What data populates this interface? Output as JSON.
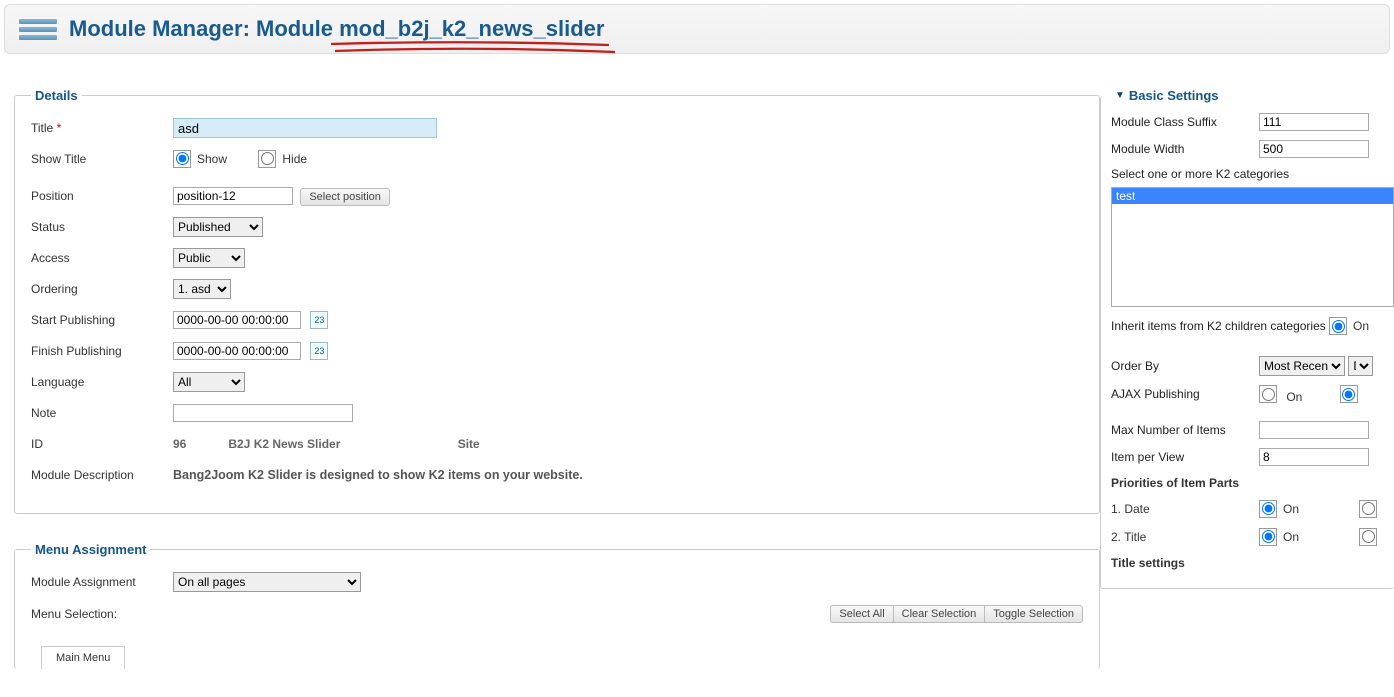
{
  "header": {
    "title": "Module Manager: Module mod_b2j_k2_news_slider"
  },
  "details": {
    "legend": "Details",
    "title_label": "Title",
    "title_value": "asd",
    "showtitle_label": "Show Title",
    "show_opt": "Show",
    "hide_opt": "Hide",
    "position_label": "Position",
    "position_value": "position-12",
    "select_position_btn": "Select position",
    "status_label": "Status",
    "status_value": "Published",
    "access_label": "Access",
    "access_value": "Public",
    "ordering_label": "Ordering",
    "ordering_value": "1. asd",
    "start_label": "Start Publishing",
    "start_value": "0000-00-00 00:00:00",
    "finish_label": "Finish Publishing",
    "finish_value": "0000-00-00 00:00:00",
    "language_label": "Language",
    "language_value": "All",
    "note_label": "Note",
    "note_value": "",
    "id_label": "ID",
    "id_value": "96",
    "module_name": "B2J K2 News Slider",
    "client": "Site",
    "desc_label": "Module Description",
    "desc_value": "Bang2Joom K2 Slider is designed to show K2 items on your website."
  },
  "menu": {
    "legend": "Menu Assignment",
    "assignment_label": "Module Assignment",
    "assignment_value": "On all pages",
    "selection_label": "Menu Selection:",
    "select_all": "Select All",
    "clear_selection": "Clear Selection",
    "toggle_selection": "Toggle Selection",
    "tab_main": "Main Menu"
  },
  "basic": {
    "legend": "Basic Settings",
    "suffix_label": "Module Class Suffix",
    "suffix_value": "111",
    "width_label": "Module Width",
    "width_value": "500",
    "k2cat_label": "Select one or more K2 categories",
    "k2cat_options": [
      "test"
    ],
    "inherit_label": "Inherit items from K2 children categories",
    "on": "On",
    "orderby_label": "Order By",
    "orderby_value": "Most Recent",
    "orderby_dir": "De",
    "ajax_label": "AJAX Publishing",
    "maxitems_label": "Max Number of Items",
    "maxitems_value": "",
    "perview_label": "Item per View",
    "perview_value": "8",
    "priorities_label": "Priorities of Item Parts",
    "prio1": "1.  Date",
    "prio2": "2.  Title",
    "titlesettings": "Title settings"
  }
}
